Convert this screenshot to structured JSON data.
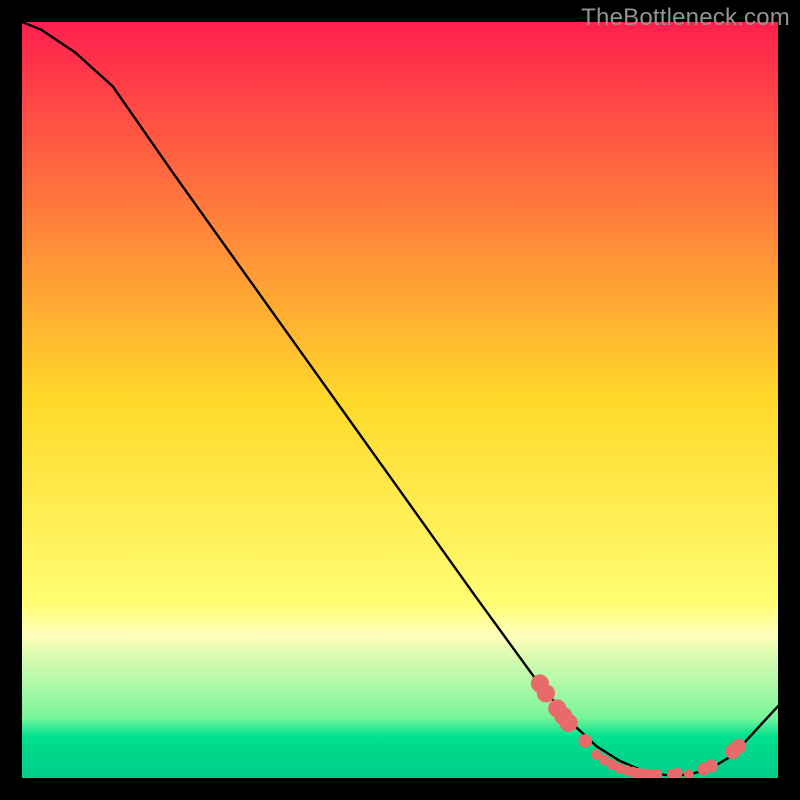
{
  "watermark": "TheBottleneck.com",
  "chart_data": {
    "type": "line",
    "title": "",
    "xlabel": "",
    "ylabel": "",
    "xlim": [
      0,
      100
    ],
    "ylim": [
      0,
      100
    ],
    "grid": false,
    "curve_color": "#000000",
    "marker_color": "#e96a6a",
    "gradient_stops": [
      {
        "pos": 0.0,
        "color": "#ff1f4e"
      },
      {
        "pos": 0.5,
        "color": "#ffd92a"
      },
      {
        "pos": 0.77,
        "color": "#fffd73"
      },
      {
        "pos": 0.81,
        "color": "#fffeb9"
      },
      {
        "pos": 0.92,
        "color": "#78f59b"
      },
      {
        "pos": 0.945,
        "color": "#00e18e"
      },
      {
        "pos": 0.97,
        "color": "#00d68b"
      },
      {
        "pos": 1.0,
        "color": "#00cf87"
      }
    ],
    "series": [
      {
        "name": "bottleneck-curve",
        "x": [
          0,
          2.5,
          7,
          12,
          20,
          30,
          40,
          50,
          60,
          68,
          73,
          76,
          79,
          82,
          85,
          88,
          91,
          94,
          100
        ],
        "y": [
          100,
          99,
          96,
          91.5,
          80,
          66,
          52,
          38,
          24,
          13,
          7,
          4.2,
          2.3,
          1.0,
          0.4,
          0.4,
          1.2,
          3.0,
          9.5
        ]
      }
    ],
    "markers": [
      {
        "x": 68.5,
        "y": 12.5,
        "r": 1.2
      },
      {
        "x": 69.3,
        "y": 11.2,
        "r": 1.2
      },
      {
        "x": 70.8,
        "y": 9.2,
        "r": 1.2
      },
      {
        "x": 71.6,
        "y": 8.2,
        "r": 1.2
      },
      {
        "x": 72.3,
        "y": 7.3,
        "r": 1.2
      },
      {
        "x": 74.5,
        "y": 4.9,
        "r": 0.9
      },
      {
        "x": 76.0,
        "y": 3.1,
        "r": 0.7
      },
      {
        "x": 77.0,
        "y": 2.4,
        "r": 0.7
      },
      {
        "x": 78.0,
        "y": 1.8,
        "r": 0.7
      },
      {
        "x": 79.0,
        "y": 1.3,
        "r": 0.7
      },
      {
        "x": 80.0,
        "y": 1.0,
        "r": 0.7
      },
      {
        "x": 80.8,
        "y": 0.8,
        "r": 0.7
      },
      {
        "x": 81.6,
        "y": 0.65,
        "r": 0.7
      },
      {
        "x": 82.4,
        "y": 0.55,
        "r": 0.7
      },
      {
        "x": 83.2,
        "y": 0.5,
        "r": 0.7
      },
      {
        "x": 84.0,
        "y": 0.5,
        "r": 0.7
      },
      {
        "x": 86.0,
        "y": 0.5,
        "r": 0.7
      },
      {
        "x": 86.7,
        "y": 0.65,
        "r": 0.7
      },
      {
        "x": 88.2,
        "y": 0.5,
        "r": 0.65
      },
      {
        "x": 90.2,
        "y": 1.2,
        "r": 0.85
      },
      {
        "x": 91.2,
        "y": 1.6,
        "r": 0.85
      },
      {
        "x": 94.0,
        "y": 3.5,
        "r": 1.0
      },
      {
        "x": 94.8,
        "y": 4.2,
        "r": 1.0
      }
    ]
  }
}
